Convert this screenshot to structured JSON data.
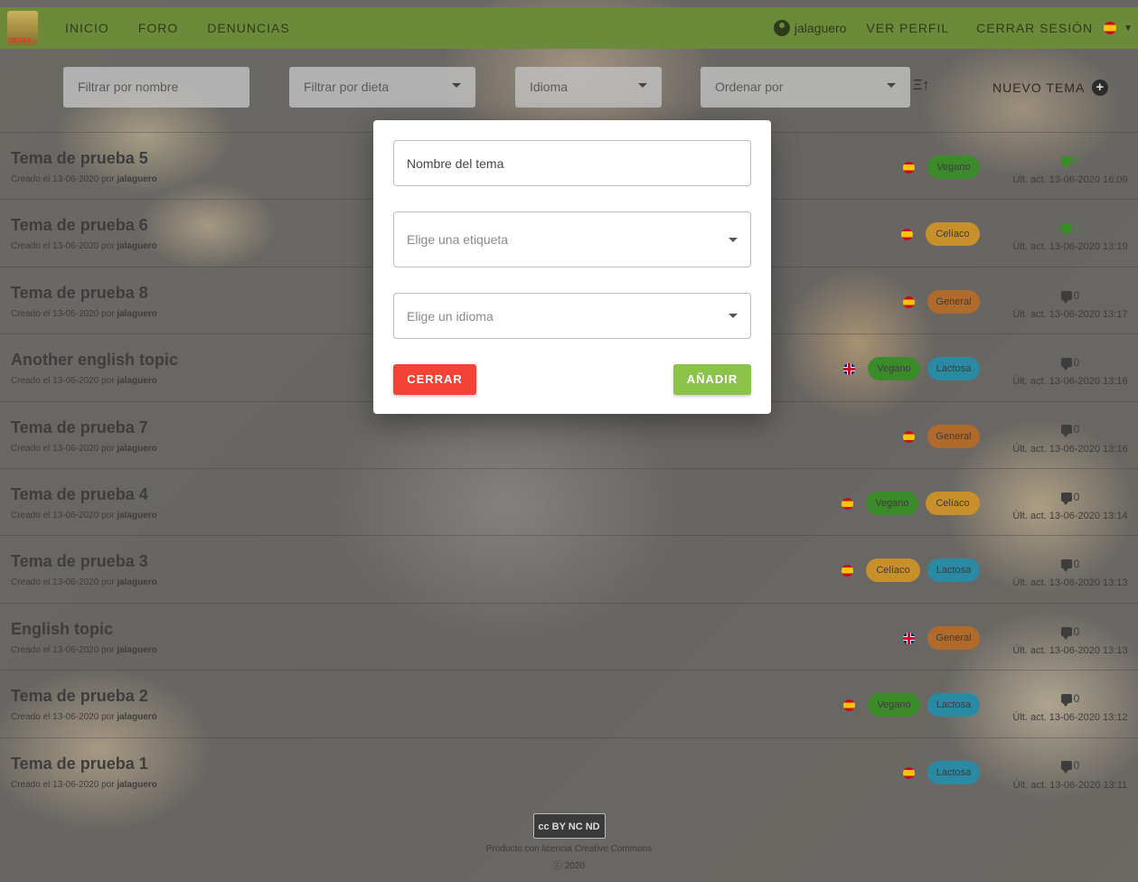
{
  "nav": {
    "logo_text": "DIETAS",
    "links": [
      "INICIO",
      "FORO",
      "DENUNCIAS"
    ],
    "user": "jalaguero",
    "profile": "VER PERFIL",
    "logout": "CERRAR SESIÓN"
  },
  "filters": {
    "name_placeholder": "Filtrar por nombre",
    "diet_placeholder": "Filtrar por dieta",
    "language_placeholder": "Idioma",
    "order_placeholder": "Ordenar por",
    "new_topic": "NUEVO TEMA"
  },
  "topics": [
    {
      "title": "Tema de prueba 5",
      "meta_prefix": "Creado el 13-06-2020 por ",
      "author": "jalaguero",
      "lang": "es",
      "tags": [
        "Vegano"
      ],
      "comments": "2",
      "comments_color": "#3c8b2b",
      "updated": "Últ. act. 13-06-2020 16:09"
    },
    {
      "title": "Tema de prueba 6",
      "meta_prefix": "Creado el 13-06-2020 por ",
      "author": "jalaguero",
      "lang": "es",
      "tags": [
        "Celíaco"
      ],
      "comments": "1",
      "comments_color": "#3c8b2b",
      "updated": "Últ. act. 13-06-2020 13:19"
    },
    {
      "title": "Tema de prueba 8",
      "meta_prefix": "Creado el 13-06-2020 por ",
      "author": "jalaguero",
      "lang": "es",
      "tags": [
        "General"
      ],
      "comments": "0",
      "comments_color": "#3d3d3d",
      "updated": "Últ. act. 13-06-2020 13:17"
    },
    {
      "title": "Another english topic",
      "meta_prefix": "Creado el 13-06-2020 por ",
      "author": "jalaguero",
      "lang": "en",
      "tags": [
        "Vegano",
        "Lactosa"
      ],
      "comments": "0",
      "comments_color": "#3d3d3d",
      "updated": "Últ. act. 13-06-2020 13:16"
    },
    {
      "title": "Tema de prueba 7",
      "meta_prefix": "Creado el 13-06-2020 por ",
      "author": "jalaguero",
      "lang": "es",
      "tags": [
        "General"
      ],
      "comments": "0",
      "comments_color": "#3d3d3d",
      "updated": "Últ. act. 13-06-2020 13:16"
    },
    {
      "title": "Tema de prueba 4",
      "meta_prefix": "Creado el 13-06-2020 por ",
      "author": "jalaguero",
      "lang": "es",
      "tags": [
        "Vegano",
        "Celíaco"
      ],
      "comments": "0",
      "comments_color": "#3d3d3d",
      "updated": "Últ. act. 13-06-2020 13:14"
    },
    {
      "title": "Tema de prueba 3",
      "meta_prefix": "Creado el 13-06-2020 por ",
      "author": "jalaguero",
      "lang": "es",
      "tags": [
        "Celíaco",
        "Lactosa"
      ],
      "comments": "0",
      "comments_color": "#3d3d3d",
      "updated": "Últ. act. 13-06-2020 13:13"
    },
    {
      "title": "English topic",
      "meta_prefix": "Creado el 13-06-2020 por ",
      "author": "jalaguero",
      "lang": "en",
      "tags": [
        "General"
      ],
      "comments": "0",
      "comments_color": "#3d3d3d",
      "updated": "Últ. act. 13-06-2020 13:13"
    },
    {
      "title": "Tema de prueba 2",
      "meta_prefix": "Creado el 13-06-2020 por ",
      "author": "jalaguero",
      "lang": "es",
      "tags": [
        "Vegano",
        "Lactosa"
      ],
      "comments": "0",
      "comments_color": "#3d3d3d",
      "updated": "Últ. act. 13-06-2020 13:12"
    },
    {
      "title": "Tema de prueba 1",
      "meta_prefix": "Creado el 13-06-2020 por ",
      "author": "jalaguero",
      "lang": "es",
      "tags": [
        "Lactosa"
      ],
      "comments": "0",
      "comments_color": "#3d3d3d",
      "updated": "Últ. act. 13-06-2020 13:11"
    }
  ],
  "footer": {
    "badge": "cc BY NC ND",
    "text": "Producto con licencia Creative Commons",
    "copyright": "ⓒ 2020"
  },
  "modal": {
    "name_value": "Nombre del tema",
    "tag_placeholder": "Elige una etiqueta",
    "language_placeholder": "Elige un idioma",
    "close_label": "CERRAR",
    "add_label": "AÑADIR"
  },
  "colors": {
    "navbar": "#6b8a3a",
    "close_button": "#f44336",
    "add_button": "#8bc34a",
    "tag_vegano": "#3c8b2b",
    "tag_celiaco": "#c7902b",
    "tag_general": "#b06a2c",
    "tag_lactosa": "#2b8aa3"
  }
}
